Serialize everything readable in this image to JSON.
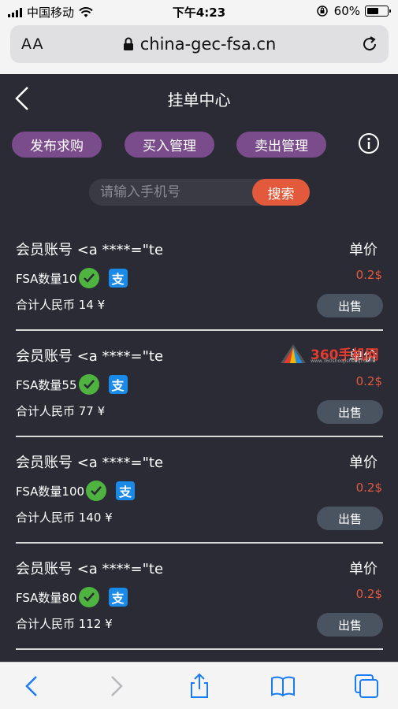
{
  "status_bar": {
    "carrier": "中国移动",
    "time": "下午4:23",
    "battery": "60%",
    "battery_level": 0.6
  },
  "browser": {
    "aa_label": "AA",
    "url": "china-gec-fsa.cn"
  },
  "header": {
    "title": "挂单中心"
  },
  "actions": {
    "post_buy": "发布求购",
    "buy_manage": "买入管理",
    "sell_manage": "卖出管理"
  },
  "search": {
    "placeholder": "请输入手机号",
    "button": "搜索"
  },
  "listings": [
    {
      "account": "会员账号 <a ****=\"te",
      "price_label": "单价",
      "quantity": "FSA数量10",
      "price": "0.2$",
      "total": "合计人民币 14 ¥",
      "sell": "出售"
    },
    {
      "account": "会员账号 <a ****=\"te",
      "price_label": "单价",
      "quantity": "FSA数量55",
      "price": "0.2$",
      "total": "合计人民币 77 ¥",
      "sell": "出售"
    },
    {
      "account": "会员账号 <a ****=\"te",
      "price_label": "单价",
      "quantity": "FSA数量100",
      "price": "0.2$",
      "total": "合计人民币 140 ¥",
      "sell": "出售"
    },
    {
      "account": "会员账号 <a ****=\"te",
      "price_label": "单价",
      "quantity": "FSA数量80",
      "price": "0.2$",
      "total": "合计人民币 112 ¥",
      "sell": "出售"
    }
  ],
  "watermark": {
    "text": "360手机网",
    "sub": "www.360shoujishenqi.com"
  },
  "icons": {
    "alipay_glyph": "支"
  },
  "colors": {
    "background": "#2b2b35",
    "pill": "#7b4c8c",
    "search_button": "#e25a3b",
    "price": "#e05a40",
    "sell_button": "#4a5461",
    "wechat": "#4fb33f",
    "alipay": "#1a8ae8"
  }
}
